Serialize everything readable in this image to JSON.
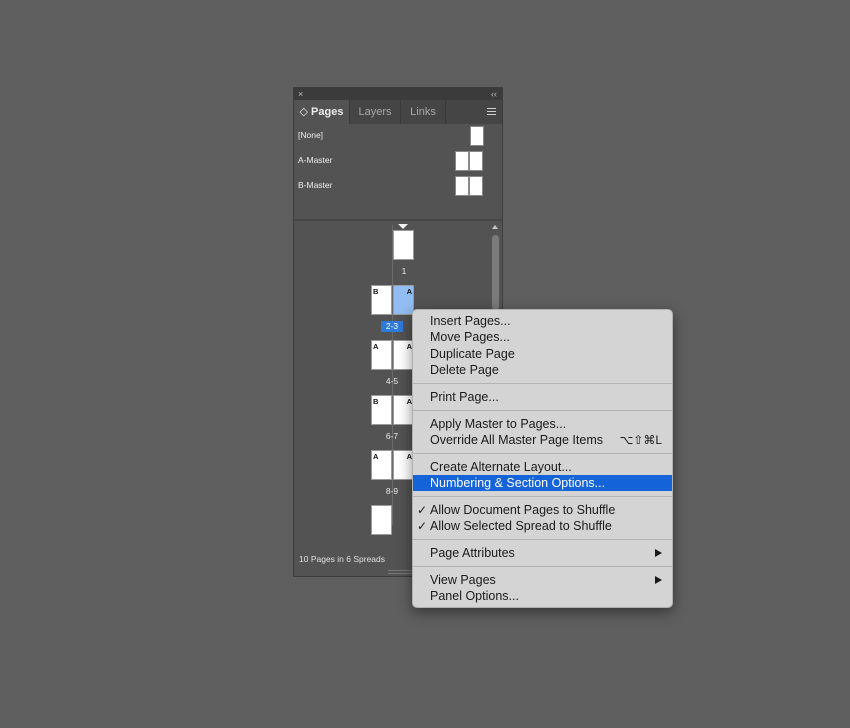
{
  "panel": {
    "close_glyph": "×",
    "collapse_glyph": "‹‹",
    "tabs": [
      {
        "label": "◇ Pages"
      },
      {
        "label": "Layers"
      },
      {
        "label": "Links"
      }
    ],
    "masters": [
      {
        "label": "[None]"
      },
      {
        "label": "A-Master"
      },
      {
        "label": "B-Master"
      }
    ],
    "pages": {
      "p1": {
        "label": "1"
      },
      "s23": {
        "label": "2-3",
        "left_master": "B",
        "right_master": "A"
      },
      "s45": {
        "label": "4-5",
        "left_master": "A",
        "right_master": "A"
      },
      "s67": {
        "label": "6-7",
        "left_master": "B",
        "right_master": "A"
      },
      "s89": {
        "label": "8-9",
        "left_master": "A",
        "right_master": "A"
      }
    },
    "status": "10 Pages in 6 Spreads"
  },
  "context_menu": {
    "insert_pages": "Insert Pages...",
    "move_pages": "Move Pages...",
    "duplicate_page": "Duplicate Page",
    "delete_page": "Delete Page",
    "print_page": "Print Page...",
    "apply_master": "Apply Master to Pages...",
    "override_master": "Override All Master Page Items",
    "override_shortcut": "⌥⇧⌘L",
    "create_alt_layout": "Create Alternate Layout...",
    "numbering": "Numbering & Section Options...",
    "allow_doc_shuffle": "Allow Document Pages to Shuffle",
    "allow_spread_shuffle": "Allow Selected Spread to Shuffle",
    "checkmark": "✓",
    "page_attributes": "Page Attributes",
    "view_pages": "View Pages",
    "panel_options": "Panel Options..."
  },
  "colors": {
    "highlight": "#1463d8",
    "selected_page": "#92bdf2",
    "background": "#5f5f5f"
  }
}
